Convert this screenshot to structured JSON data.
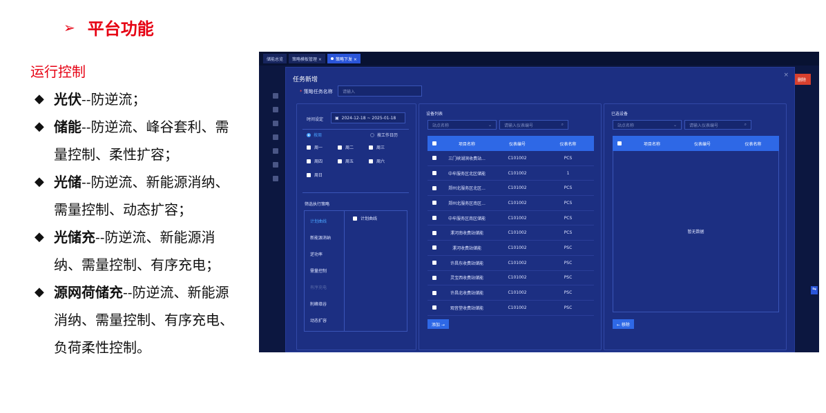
{
  "doc": {
    "heading_arrow": "➢",
    "heading": "平台功能",
    "subhead": "运行控制",
    "bullets": [
      {
        "term": "光伏",
        "desc": "--防逆流；"
      },
      {
        "term": "储能",
        "desc": "--防逆流、峰谷套利、需量控制、柔性扩容；"
      },
      {
        "term": "光储",
        "desc": "--防逆流、新能源消纳、需量控制、动态扩容；"
      },
      {
        "term": "光储充",
        "desc": "--防逆流、新能源消纳、需量控制、有序充电；"
      },
      {
        "term": "源网荷储充",
        "desc": "--防逆流、新能源消纳、需量控制、有序充电、负荷柔性控制。"
      }
    ],
    "diamond": "◆"
  },
  "app": {
    "tabs": [
      "储能总览",
      "策略模板管理 ×",
      "策略下发 ×"
    ],
    "bg_red_button": "删除",
    "bg_search": "请输",
    "modal": {
      "title": "任务新增",
      "close": "×",
      "name_label": "策略任务名称",
      "name_placeholder": "请输入"
    },
    "time": {
      "label": "时间设定",
      "range": "2024-12-18 ~ 2025-01-18",
      "mode_week": "按周",
      "mode_workday": "按工作日历",
      "days": [
        "周一",
        "周二",
        "周三",
        "周四",
        "周五",
        "周六",
        "周日"
      ]
    },
    "strategy": {
      "label": "筛选执行策略",
      "items": [
        "计划曲线",
        "新能源消纳",
        "逆功率",
        "需量控制",
        "有序充电",
        "削峰填谷",
        "动态扩容"
      ],
      "right_option": "计划曲线"
    },
    "device_list": {
      "title": "设备列表",
      "site_placeholder": "站点名称",
      "meter_placeholder": "请输入仪表编号",
      "columns": [
        "项目名称",
        "仪表编号",
        "仪表名称"
      ],
      "rows": [
        [
          "三门峡湖滨收费站...",
          "C101002",
          "PCS"
        ],
        [
          "中牟服务区北区储能",
          "C101002",
          "1"
        ],
        [
          "郑州北服务区北区...",
          "C101002",
          "PCS"
        ],
        [
          "郑州北服务区南区...",
          "C101002",
          "PCS"
        ],
        [
          "中牟服务区南区储能",
          "C101002",
          "PCS"
        ],
        [
          "漯河南收费站储能",
          "C101002",
          "PCS"
        ],
        [
          "漯河收费站储能",
          "C101002",
          "PSC"
        ],
        [
          "许昌东收费站储能",
          "C101002",
          "PSC"
        ],
        [
          "灵宝西收费站储能",
          "C101002",
          "PSC"
        ],
        [
          "许昌北收费站储能",
          "C101002",
          "PSC"
        ],
        [
          "观音堂收费站储能",
          "C101002",
          "PSC"
        ]
      ],
      "add_button": "添加 →"
    },
    "selected": {
      "title": "已选设备",
      "site_placeholder": "站点名称",
      "meter_placeholder": "请输入仪表编号",
      "columns": [
        "项目名称",
        "仪表编号",
        "仪表名称"
      ],
      "empty": "暂无数据",
      "remove_button": "← 移除"
    }
  }
}
